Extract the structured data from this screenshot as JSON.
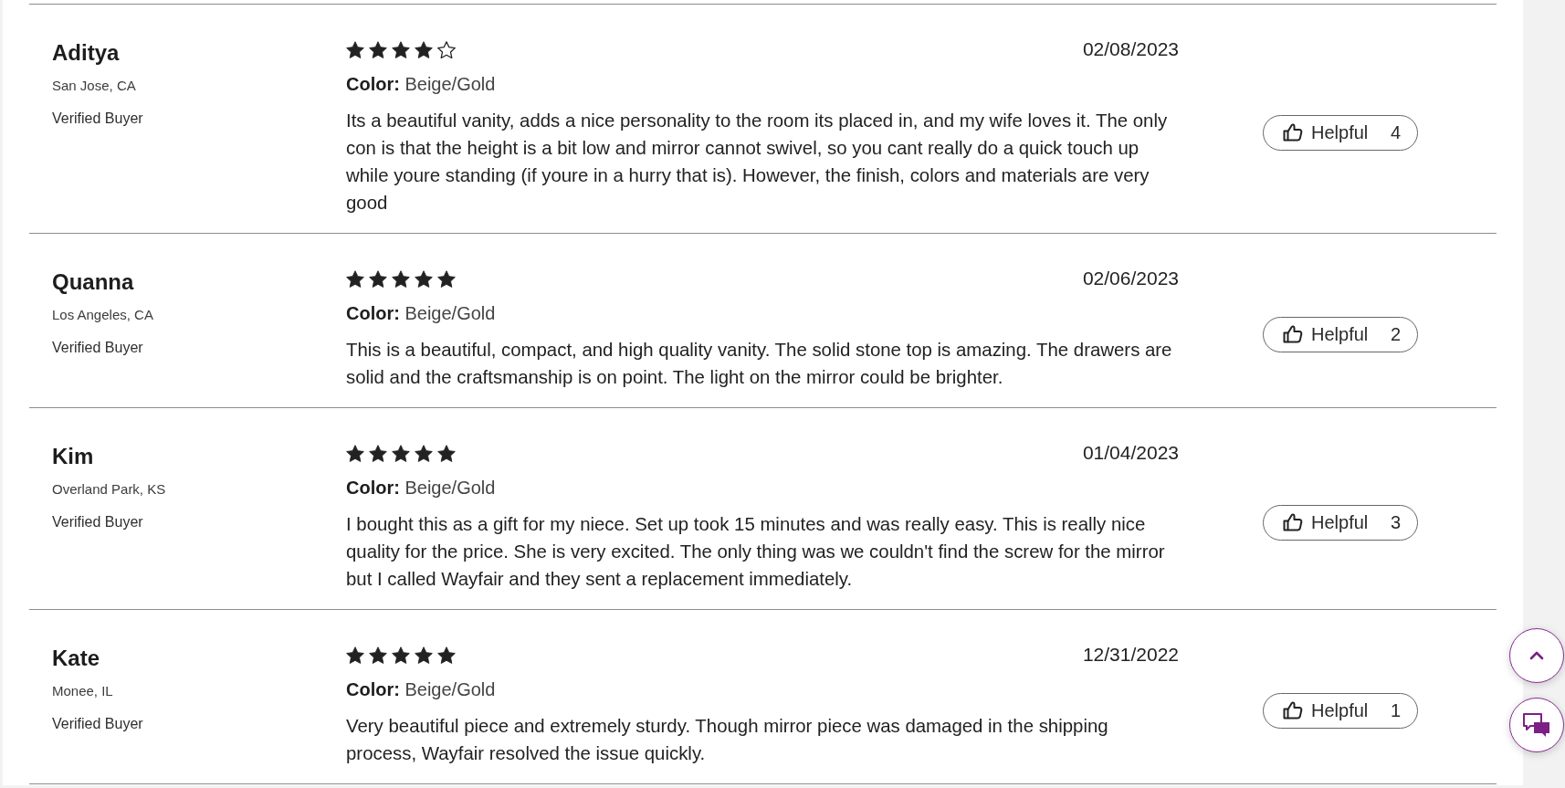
{
  "reviews": [
    {
      "name": "Aditya",
      "location": "San Jose, CA",
      "badge": "Verified Buyer",
      "stars": 4,
      "date": "02/08/2023",
      "option_label": "Color:",
      "option_value": "Beige/Gold",
      "text": "Its a beautiful vanity, adds a nice personality to the room its placed in, and my wife loves it. The only con is that the height is a bit low and mirror cannot swivel, so you cant really do a quick touch up while youre standing (if youre in a hurry that is). However, the finish, colors and materials are very good",
      "helpful": {
        "label": "Helpful",
        "count": "4"
      }
    },
    {
      "name": "Quanna",
      "location": "Los Angeles, CA",
      "badge": "Verified Buyer",
      "stars": 5,
      "date": "02/06/2023",
      "option_label": "Color:",
      "option_value": "Beige/Gold",
      "text": "This is a beautiful, compact, and high quality vanity. The solid stone top is amazing. The drawers are solid and the craftsmanship is on point. The light on the mirror could be brighter.",
      "helpful": {
        "label": "Helpful",
        "count": "2"
      }
    },
    {
      "name": "Kim",
      "location": "Overland Park, KS",
      "badge": "Verified Buyer",
      "stars": 5,
      "date": "01/04/2023",
      "option_label": "Color:",
      "option_value": "Beige/Gold",
      "text": "I bought this as a gift for my niece. Set up took 15 minutes and was really easy. This is really nice quality for the price. She is very excited. The only thing was we couldn't find the screw for the mirror but I called Wayfair and they sent a replacement immediately.",
      "helpful": {
        "label": "Helpful",
        "count": "3"
      }
    },
    {
      "name": "Kate",
      "location": "Monee, IL",
      "badge": "Verified Buyer",
      "stars": 5,
      "date": "12/31/2022",
      "option_label": "Color:",
      "option_value": "Beige/Gold",
      "text": "Very beautiful piece and extremely sturdy. Though mirror piece was damaged in the shipping process, Wayfair resolved the issue quickly.",
      "helpful": {
        "label": "Helpful",
        "count": "1"
      }
    }
  ],
  "floating_buttons": [
    {
      "kind": "scroll_top"
    },
    {
      "kind": "chat"
    }
  ]
}
